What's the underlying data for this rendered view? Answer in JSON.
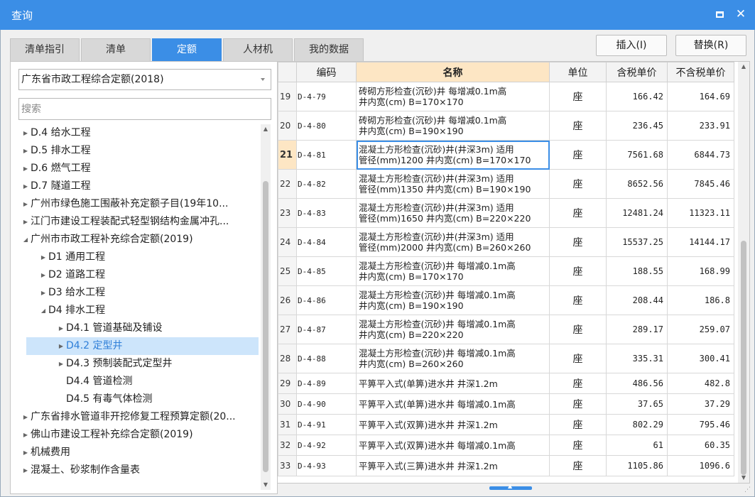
{
  "window": {
    "title": "查询",
    "maximize_icon": "maximize-icon",
    "close_icon": "close-icon",
    "close_glyph": "✕",
    "accent": "#3b8ee6"
  },
  "tabs": [
    {
      "label": "清单指引",
      "active": false
    },
    {
      "label": "清单",
      "active": false
    },
    {
      "label": "定额",
      "active": true
    },
    {
      "label": "人材机",
      "active": false
    },
    {
      "label": "我的数据",
      "active": false
    }
  ],
  "actions": {
    "insert_label": "插入(I)",
    "replace_label": "替换(R)"
  },
  "left": {
    "dropdown_value": "广东省市政工程综合定额(2018)",
    "search_placeholder": "搜索",
    "tree": [
      {
        "label": "D.4 给水工程",
        "arrow": "▶"
      },
      {
        "label": "D.5 排水工程",
        "arrow": "▶"
      },
      {
        "label": "D.6 燃气工程",
        "arrow": "▶"
      },
      {
        "label": "D.7 隧道工程",
        "arrow": "▶"
      },
      {
        "label": "广州市绿色施工围蔽补充定额子目(19年10...",
        "arrow": "▶"
      },
      {
        "label": "江门市建设工程装配式轻型钢结构金属冲孔...",
        "arrow": "▶"
      },
      {
        "label": "广州市市政工程补充综合定额(2019)",
        "arrow": "◢"
      },
      {
        "label": "D1 通用工程",
        "arrow": "▶"
      },
      {
        "label": "D2 道路工程",
        "arrow": "▶"
      },
      {
        "label": "D3 给水工程",
        "arrow": "▶"
      },
      {
        "label": "D4 排水工程",
        "arrow": "◢"
      },
      {
        "label": "D4.1 管道基础及铺设",
        "arrow": "▶"
      },
      {
        "label": "D4.2 定型井",
        "arrow": "▶",
        "selected": true
      },
      {
        "label": "D4.3 预制装配式定型井",
        "arrow": "▶"
      },
      {
        "label": "D4.4 管道检测",
        "arrow": ""
      },
      {
        "label": "D4.5 有毒气体检测",
        "arrow": ""
      },
      {
        "label": "广东省排水管道非开挖修复工程预算定额(20...",
        "arrow": "▶"
      },
      {
        "label": "佛山市建设工程补充综合定额(2019)",
        "arrow": "▶"
      },
      {
        "label": "机械费用",
        "arrow": "▶"
      },
      {
        "label": "混凝土、砂浆制作含量表",
        "arrow": "▶"
      }
    ]
  },
  "grid": {
    "headers": [
      "编码",
      "名称",
      "单位",
      "含税单价",
      "不含税单价"
    ],
    "rows": [
      {
        "no": "19",
        "code": "D-4-79",
        "name1": "砖砌方形检查(沉砂)井 每增减0.1m高",
        "name2": "井内宽(cm) B=170×170",
        "unit": "座",
        "tax_price": "166.42",
        "notax_price": "164.69"
      },
      {
        "no": "20",
        "code": "D-4-80",
        "name1": "砖砌方形检查(沉砂)井 每增减0.1m高",
        "name2": "井内宽(cm) B=190×190",
        "unit": "座",
        "tax_price": "236.45",
        "notax_price": "233.91"
      },
      {
        "no": "21",
        "code": "D-4-81",
        "name1": "混凝土方形检查(沉砂)井(井深3m) 适用",
        "name2": "管径(mm)1200 井内宽(cm) B=170×170",
        "unit": "座",
        "tax_price": "7561.68",
        "notax_price": "6844.73",
        "selected": true
      },
      {
        "no": "22",
        "code": "D-4-82",
        "name1": "混凝土方形检查(沉砂)井(井深3m) 适用",
        "name2": "管径(mm)1350 井内宽(cm) B=190×190",
        "unit": "座",
        "tax_price": "8652.56",
        "notax_price": "7845.46"
      },
      {
        "no": "23",
        "code": "D-4-83",
        "name1": "混凝土方形检查(沉砂)井(井深3m) 适用",
        "name2": "管径(mm)1650 井内宽(cm) B=220×220",
        "unit": "座",
        "tax_price": "12481.24",
        "notax_price": "11323.11"
      },
      {
        "no": "24",
        "code": "D-4-84",
        "name1": "混凝土方形检查(沉砂)井(井深3m) 适用",
        "name2": "管径(mm)2000 井内宽(cm) B=260×260",
        "unit": "座",
        "tax_price": "15537.25",
        "notax_price": "14144.17"
      },
      {
        "no": "25",
        "code": "D-4-85",
        "name1": "混凝土方形检查(沉砂)井 每增减0.1m高",
        "name2": "井内宽(cm) B=170×170",
        "unit": "座",
        "tax_price": "188.55",
        "notax_price": "168.99"
      },
      {
        "no": "26",
        "code": "D-4-86",
        "name1": "混凝土方形检查(沉砂)井 每增减0.1m高",
        "name2": "井内宽(cm) B=190×190",
        "unit": "座",
        "tax_price": "208.44",
        "notax_price": "186.8"
      },
      {
        "no": "27",
        "code": "D-4-87",
        "name1": "混凝土方形检查(沉砂)井 每增减0.1m高",
        "name2": "井内宽(cm) B=220×220",
        "unit": "座",
        "tax_price": "289.17",
        "notax_price": "259.07"
      },
      {
        "no": "28",
        "code": "D-4-88",
        "name1": "混凝土方形检查(沉砂)井 每增减0.1m高",
        "name2": "井内宽(cm) B=260×260",
        "unit": "座",
        "tax_price": "335.31",
        "notax_price": "300.41"
      },
      {
        "no": "29",
        "code": "D-4-89",
        "name1": "平箅平入式(单箅)进水井 井深1.2m",
        "name2": "",
        "unit": "座",
        "tax_price": "486.56",
        "notax_price": "482.8"
      },
      {
        "no": "30",
        "code": "D-4-90",
        "name1": "平箅平入式(单箅)进水井 每增减0.1m高",
        "name2": "",
        "unit": "座",
        "tax_price": "37.65",
        "notax_price": "37.29"
      },
      {
        "no": "31",
        "code": "D-4-91",
        "name1": "平箅平入式(双箅)进水井 井深1.2m",
        "name2": "",
        "unit": "座",
        "tax_price": "802.29",
        "notax_price": "795.46"
      },
      {
        "no": "32",
        "code": "D-4-92",
        "name1": "平箅平入式(双箅)进水井 每增减0.1m高",
        "name2": "",
        "unit": "座",
        "tax_price": "61",
        "notax_price": "60.35"
      },
      {
        "no": "33",
        "code": "D-4-93",
        "name1": "平箅平入式(三箅)进水井 井深1.2m",
        "name2": "",
        "unit": "座",
        "tax_price": "1105.86",
        "notax_price": "1096.6"
      }
    ]
  }
}
